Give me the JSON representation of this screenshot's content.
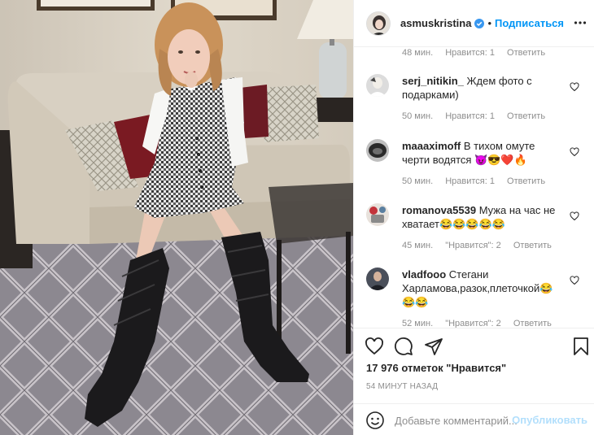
{
  "post": {
    "username": "asmuskristina",
    "separator": "•",
    "follow_label": "Подписаться"
  },
  "previous_comment_meta": {
    "time": "48 мин.",
    "likes": "Нравится: 1",
    "reply": "Ответить"
  },
  "comments": [
    {
      "username": "serj_nitikin_",
      "text": "Ждем фото с подарками)",
      "time": "50 мин.",
      "likes": "Нравится: 1",
      "reply": "Ответить"
    },
    {
      "username": "maaaximoff",
      "text": "В тихом омуте черти водятся 😈😎❤️🔥",
      "time": "50 мин.",
      "likes": "Нравится: 1",
      "reply": "Ответить"
    },
    {
      "username": "romanova5539",
      "text": "Мужа на час не хватает😂😂😂😂😂",
      "time": "45 мин.",
      "likes": "\"Нравится\": 2",
      "reply": "Ответить"
    },
    {
      "username": "vladfooo",
      "text": "Стегани Харламова,разок,плеточкой😂😂😂",
      "time": "52 мин.",
      "likes": "\"Нравится\": 2",
      "reply": "Ответить"
    }
  ],
  "likes_text": "17 976 отметок \"Нравится\"",
  "timestamp": "54 минут назад",
  "add_comment": {
    "placeholder": "Добавьте комментарий...",
    "publish_label": "Опубликовать"
  },
  "icons": {
    "verified": "verified-badge-icon",
    "more": "more-options-icon",
    "like": "heart-icon",
    "comment": "comment-icon",
    "share": "share-icon",
    "save": "bookmark-icon",
    "emoji": "emoji-icon"
  },
  "colors": {
    "accent": "#0095f6",
    "publish_disabled": "#b2dffc",
    "muted": "#8e8e8e",
    "text": "#262626"
  }
}
